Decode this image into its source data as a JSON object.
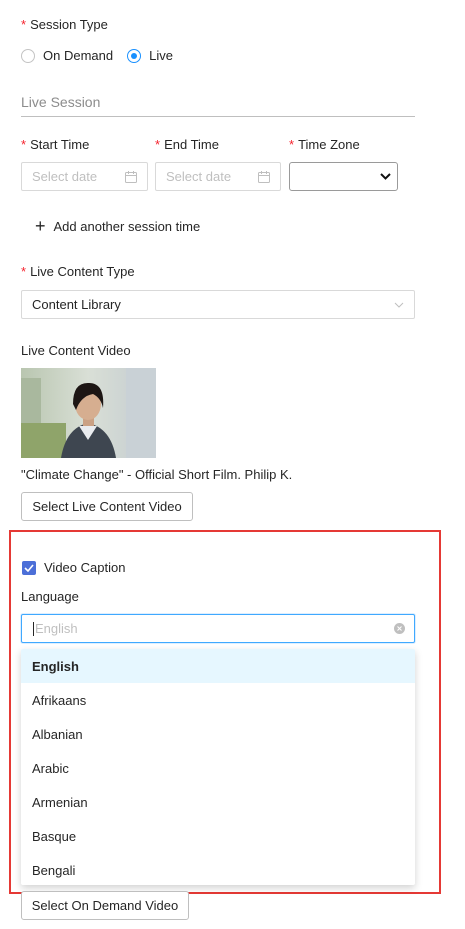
{
  "session_type": {
    "label": "Session Type",
    "options": [
      {
        "label": "On Demand",
        "checked": false
      },
      {
        "label": "Live",
        "checked": true
      }
    ]
  },
  "live_session": {
    "heading": "Live Session",
    "start_time": {
      "label": "Start Time",
      "placeholder": "Select date"
    },
    "end_time": {
      "label": "End Time",
      "placeholder": "Select date"
    },
    "time_zone": {
      "label": "Time Zone",
      "value": ""
    },
    "add_session_label": "Add another session time"
  },
  "live_content": {
    "type_label": "Live Content Type",
    "type_value": "Content Library",
    "video_label": "Live Content Video",
    "video_title": "\"Climate Change\" - Official Short Film. Philip K.",
    "select_button": "Select Live Content Video"
  },
  "caption": {
    "checkbox_label": "Video Caption",
    "checked": true,
    "language_label": "Language",
    "language_placeholder": "English",
    "options": [
      "English",
      "Afrikaans",
      "Albanian",
      "Arabic",
      "Armenian",
      "Basque",
      "Bengali"
    ],
    "active_option": "English"
  },
  "on_demand": {
    "select_button": "Select On Demand Video"
  },
  "colors": {
    "required": "#f5222d",
    "primary": "#1890ff",
    "checkbox": "#4c6fd8",
    "highlight": "#e53935",
    "active_option_bg": "#e6f7ff"
  }
}
